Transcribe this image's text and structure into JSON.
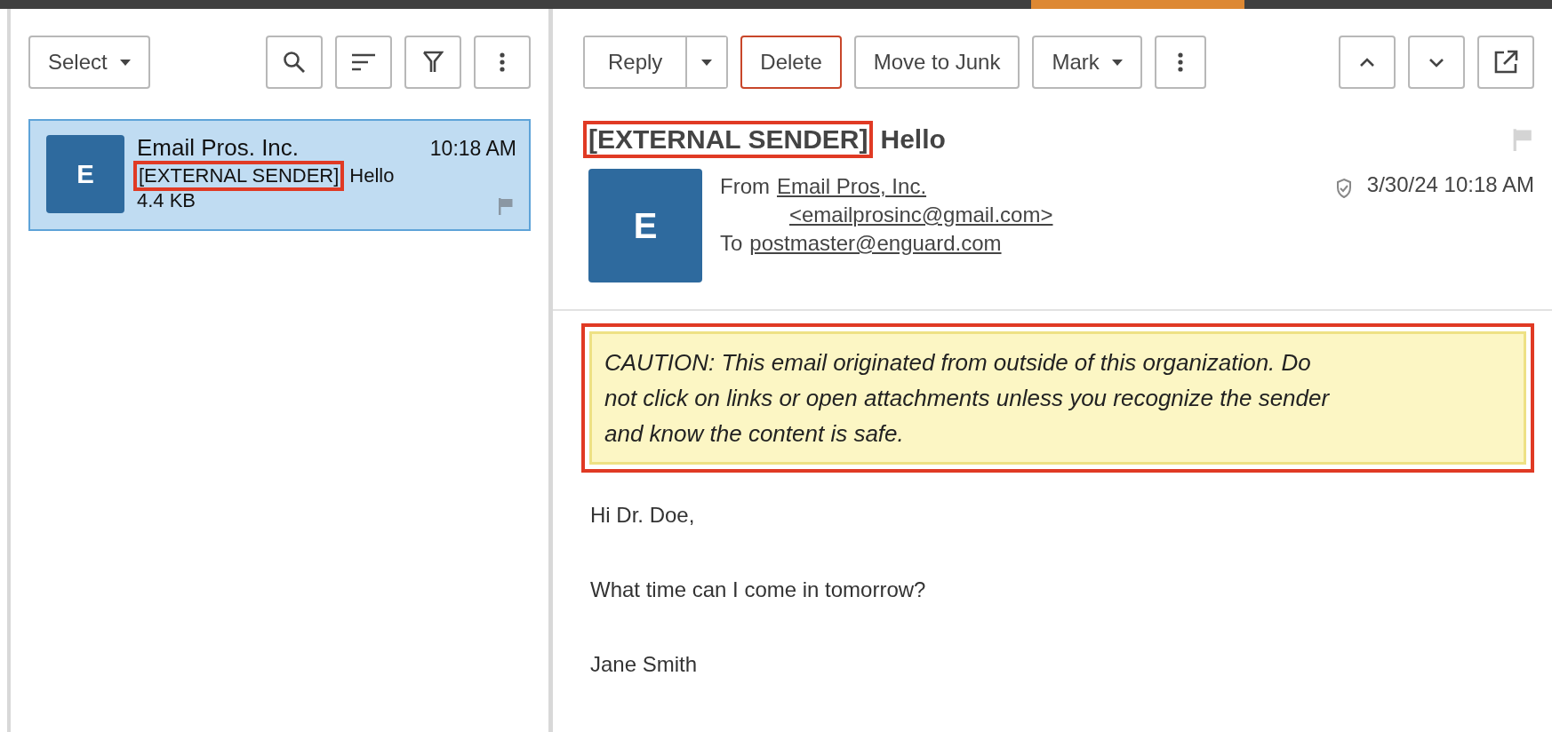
{
  "list_toolbar": {
    "select_label": "Select"
  },
  "messages": [
    {
      "avatar_letter": "E",
      "sender": "Email Pros. Inc.",
      "time": "10:18 AM",
      "subject_tag": "[EXTERNAL SENDER]",
      "subject": "Hello",
      "size": "4.4 KB",
      "selected": true,
      "tag_highlighted": true
    }
  ],
  "reader_toolbar": {
    "buttons": [
      {
        "label": "Reply",
        "kind": "split"
      },
      {
        "label": "Delete",
        "kind": "danger"
      },
      {
        "label": "Move to Junk",
        "kind": "plain"
      },
      {
        "label": "Mark",
        "kind": "dropdown"
      }
    ]
  },
  "message": {
    "subject_tag": "[EXTERNAL SENDER]",
    "subject": "Hello",
    "tag_highlighted": true,
    "avatar_letter": "E",
    "from_label": "From",
    "from_name": "Email Pros, Inc.",
    "from_address": "<emailprosinc@gmail.com>",
    "to_label": "To",
    "to_address": "postmaster@enguard.com",
    "date": "3/30/24 10:18 AM",
    "caution": "CAUTION: This email originated from outside of this organization. Do not click on links or open attachments unless you recognize the sender and know the content is safe.",
    "caution_highlighted": true,
    "body": [
      "Hi Dr. Doe,",
      "What time can I come in tomorrow?",
      "Jane Smith"
    ]
  }
}
